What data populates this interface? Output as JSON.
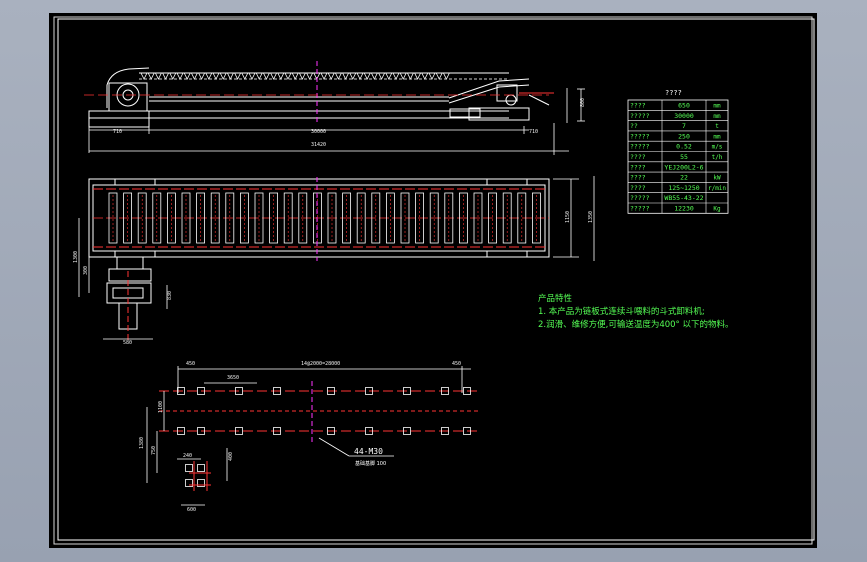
{
  "drawing": {
    "top_view_dims": {
      "left": "710",
      "middle": "30000",
      "right": "710",
      "height": "800",
      "total": "31420"
    },
    "plan_view_dims": {
      "inner": "1150",
      "outer": "1350",
      "side_a": "1300",
      "side_b": "300",
      "motor_w": "580",
      "motor_h": "830"
    },
    "table": {
      "title": "????",
      "rows": [
        {
          "name": "????",
          "value": "650",
          "unit": "mm"
        },
        {
          "name": "?????",
          "value": "30000",
          "unit": "mm"
        },
        {
          "name": "??",
          "value": "7",
          "unit": "t"
        },
        {
          "name": "?????",
          "value": "250",
          "unit": "mm"
        },
        {
          "name": "?????",
          "value": "0.52",
          "unit": "m/s"
        },
        {
          "name": "????",
          "value": "55",
          "unit": "t/h"
        },
        {
          "name": "????",
          "value": "YEJ200L2-6",
          "unit": ""
        },
        {
          "name": "????",
          "value": "22",
          "unit": "kW"
        },
        {
          "name": "????",
          "value": "125~1250",
          "unit": "r/min"
        },
        {
          "name": "?????",
          "value": "WB55-43-22",
          "unit": ""
        },
        {
          "name": "?????",
          "value": "12230",
          "unit": "Kg"
        }
      ]
    },
    "notes": {
      "title": "产品特性",
      "line1": "1. 本产品为链板式连续斗喂料的斗式卸料机;",
      "line2": "2.润滑、维修方便,可输送温度为400° 以下的物料。"
    },
    "foundation": {
      "d_top_left": "450",
      "d_top_mid": "14@2000=28000",
      "d_top_right": "450",
      "d_sub": "3650",
      "d_row": "1100",
      "d_side1": "1380",
      "d_side2": "750",
      "d_small_w": "240",
      "d_small_h": "400",
      "d_small_bottom": "600",
      "callout": "44-M30",
      "callout_sub": "基础基脚 100"
    }
  }
}
